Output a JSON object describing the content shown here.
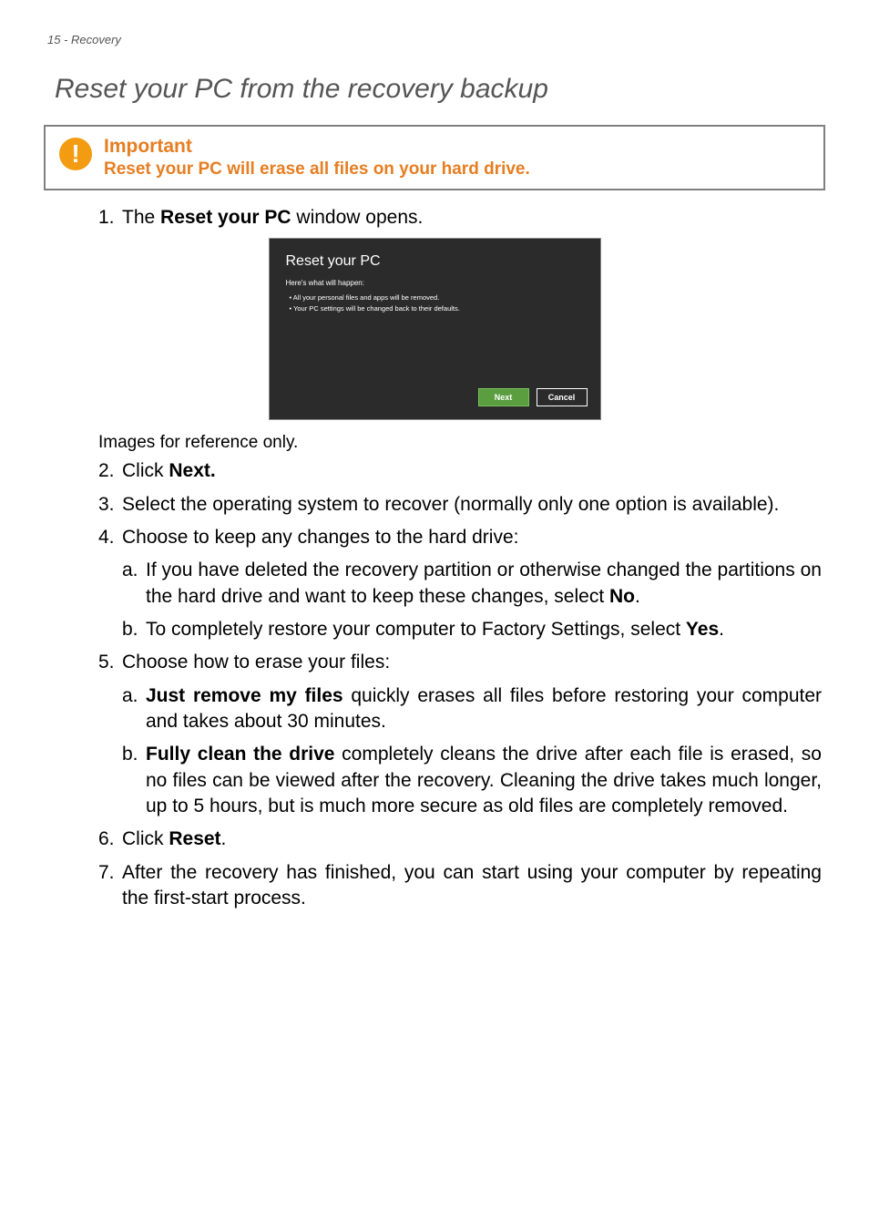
{
  "page": {
    "header": "15 - Recovery",
    "section_title": "Reset your PC from the recovery backup",
    "caption": "Images for reference only."
  },
  "important": {
    "title": "Important",
    "text": "Reset your PC will erase all files on your hard drive."
  },
  "steps": {
    "s1_num": "1.",
    "s1_a": "The ",
    "s1_b": "Reset your PC",
    "s1_c": " window opens.",
    "s2_num": "2.",
    "s2_a": "Click ",
    "s2_b": "Next.",
    "s3_num": "3.",
    "s3": "Select the operating system to recover (normally only one option is available).",
    "s4_num": "4.",
    "s4": "Choose to keep any changes to the hard drive:",
    "s4a_num": "a.",
    "s4a_a": "If you have deleted the recovery partition or otherwise changed the partitions on the hard drive and want to keep these changes, select ",
    "s4a_b": "No",
    "s4a_c": ".",
    "s4b_num": "b.",
    "s4b_a": "To completely restore your computer to Factory Settings, select ",
    "s4b_b": "Yes",
    "s4b_c": ".",
    "s5_num": "5.",
    "s5": "Choose how to erase your files:",
    "s5a_num": "a.",
    "s5a_b": "Just remove my files",
    "s5a_a": " quickly erases all files before restoring your computer and takes about 30 minutes.",
    "s5b_num": "b.",
    "s5b_b": "Fully clean the drive",
    "s5b_a": " completely cleans the drive after each file is erased, so no files can be viewed after the recovery. Cleaning the drive takes much longer, up to 5 hours, but is much more secure as old files are completely removed.",
    "s6_num": "6.",
    "s6_a": "Click ",
    "s6_b": "Reset",
    "s6_c": ".",
    "s7_num": "7.",
    "s7": "After the recovery has finished, you can start using your computer by repeating the first-start process."
  },
  "screenshot": {
    "title": "Reset your PC",
    "sub": "Here's what will happen:",
    "bullet1": "• All your personal files and apps will be removed.",
    "bullet2": "• Your PC settings will be changed back to their defaults.",
    "next": "Next",
    "cancel": "Cancel"
  }
}
